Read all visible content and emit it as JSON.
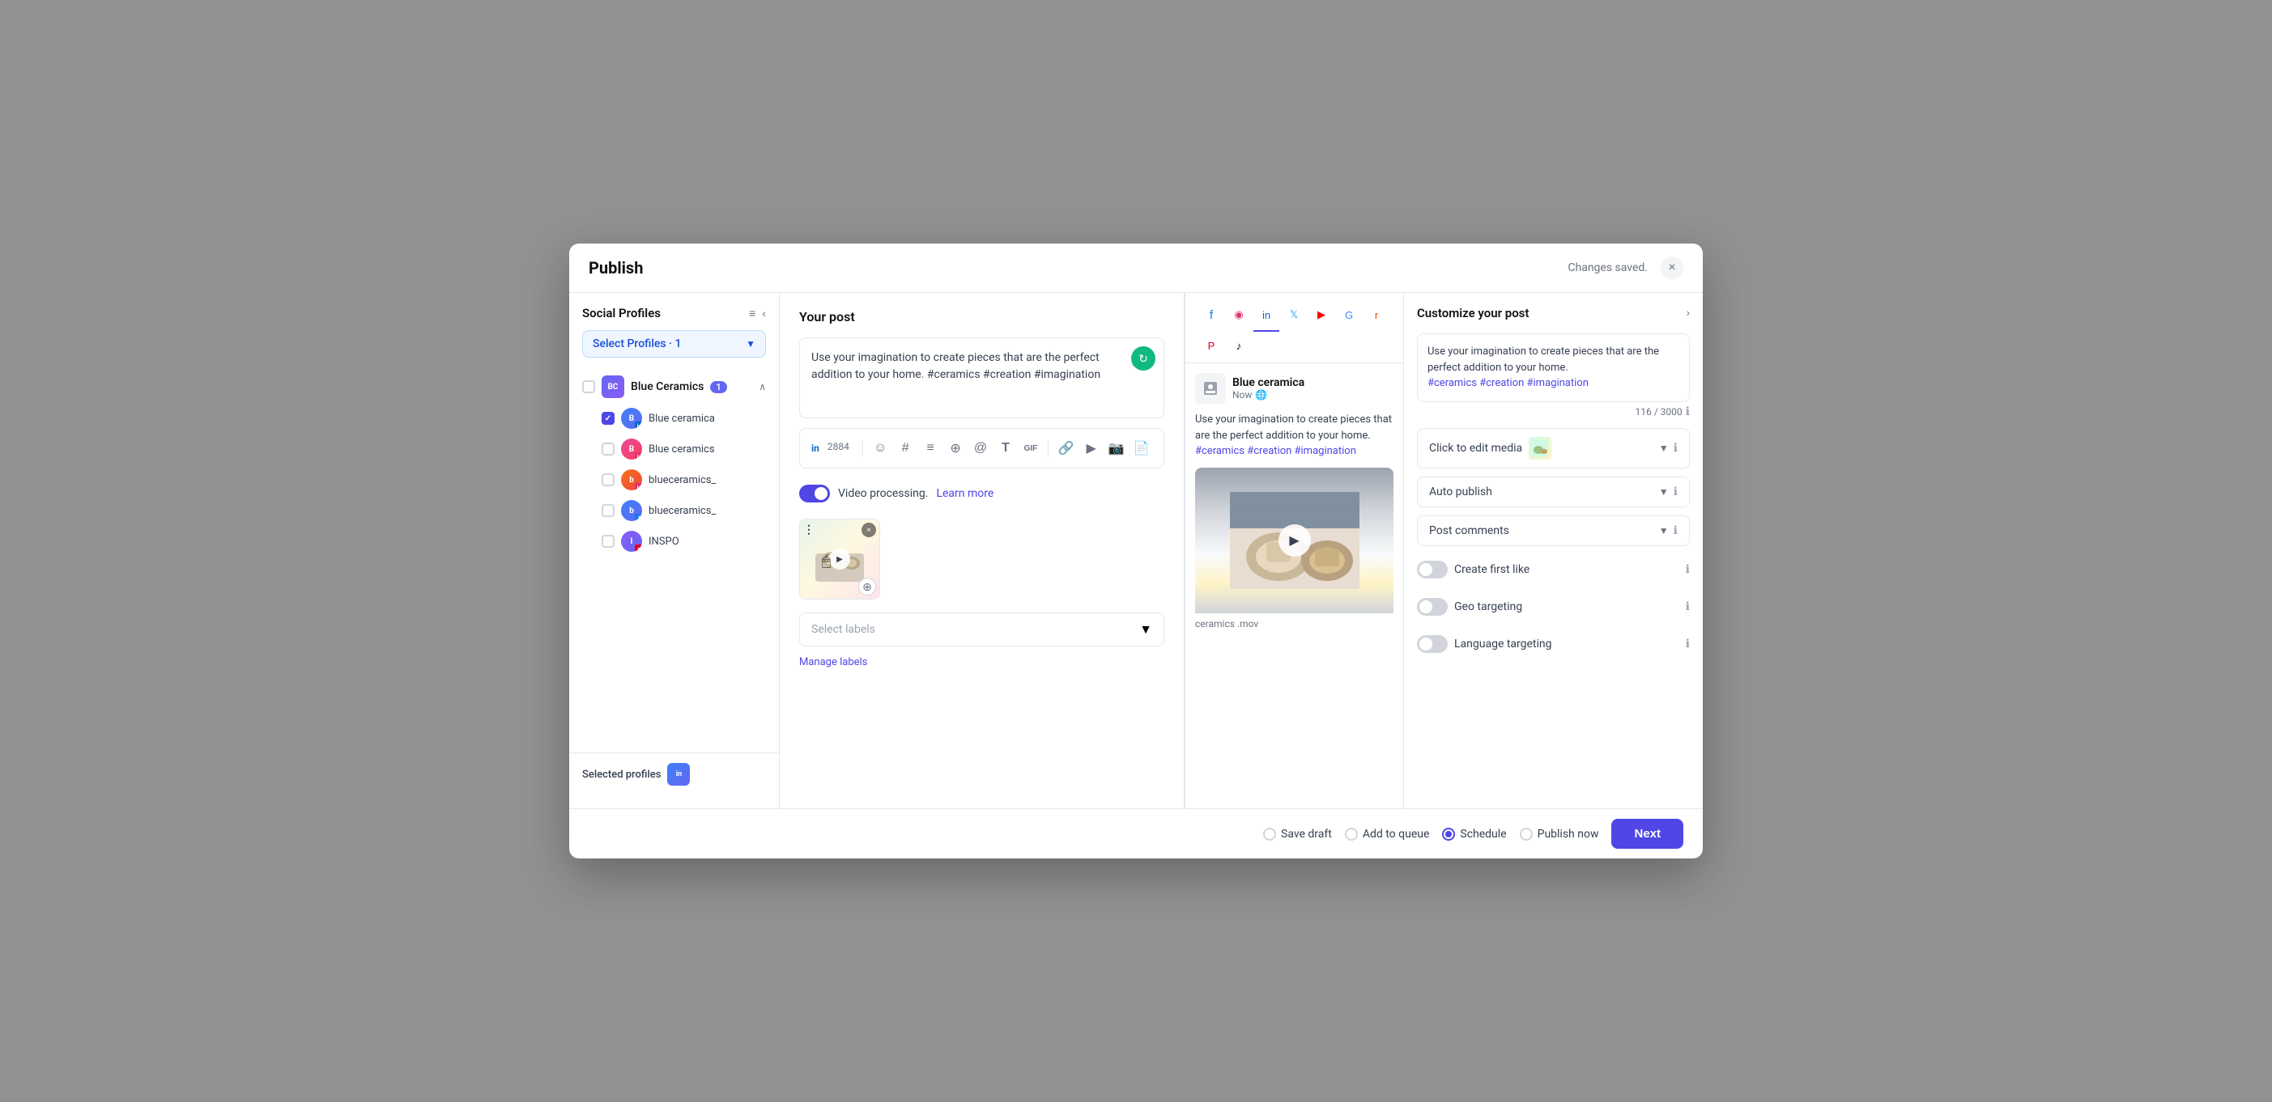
{
  "modal": {
    "title": "Publish",
    "changes_saved": "Changes saved.",
    "close_label": "×"
  },
  "sidebar": {
    "title": "Social Profiles",
    "filter_icon": "≡",
    "collapse_icon": "‹",
    "select_profiles_label": "Select Profiles · 1",
    "groups": [
      {
        "name": "Blue Ceramics",
        "count": 1,
        "profiles": [
          {
            "name": "Blue ceramica",
            "checked": true,
            "platform": "linkedin"
          },
          {
            "name": "Blue ceramics",
            "checked": false,
            "platform": "instagram"
          },
          {
            "name": "blueceramics_",
            "checked": false,
            "platform": "instagram"
          },
          {
            "name": "blueceramics_",
            "checked": false,
            "platform": "facebook"
          },
          {
            "name": "INSPO",
            "checked": false,
            "platform": "pinterest"
          }
        ]
      }
    ],
    "selected_profiles_label": "Selected profiles"
  },
  "post": {
    "title": "Your post",
    "text": "Use your imagination to create pieces that are the perfect addition to your home. #ceramics #creation #imagination",
    "char_count": "2884",
    "video_processing_text": "Video processing.",
    "learn_more_text": "Learn more",
    "labels_placeholder": "Select labels",
    "manage_labels": "Manage labels",
    "video_filename": "ceramics.mov"
  },
  "toolbar": {
    "emoji": "☺",
    "hashtag": "#",
    "text": "≡",
    "add": "+",
    "mention": "@",
    "font": "T",
    "gif": "GIF",
    "link": "🔗",
    "video": "▶",
    "camera": "📷",
    "doc": "📄"
  },
  "preview": {
    "profile_name": "Blue ceramica",
    "time": "Now",
    "text": "Use your imagination to create pieces that are the perfect addition to your home.",
    "hashtags": "#ceramics #creation #imagination",
    "filename": "ceramics .mov",
    "platforms": [
      "facebook",
      "instagram",
      "linkedin",
      "twitter",
      "youtube",
      "google",
      "reddit",
      "pinterest",
      "tiktok"
    ]
  },
  "customization": {
    "title": "Customize your post",
    "text": "Use your imagination to create pieces that are the perfect addition to your home.",
    "hashtags": "#ceramics #creation #imagination",
    "char_count": "116 / 3000",
    "click_to_edit_media": "Click to edit media",
    "auto_publish": "Auto publish",
    "post_comments": "Post comments",
    "create_first_like": "Create first like",
    "geo_targeting": "Geo targeting",
    "language_targeting": "Language targeting"
  },
  "footer": {
    "save_draft": "Save draft",
    "add_to_queue": "Add to queue",
    "schedule": "Schedule",
    "publish_now": "Publish now",
    "next": "Next"
  }
}
